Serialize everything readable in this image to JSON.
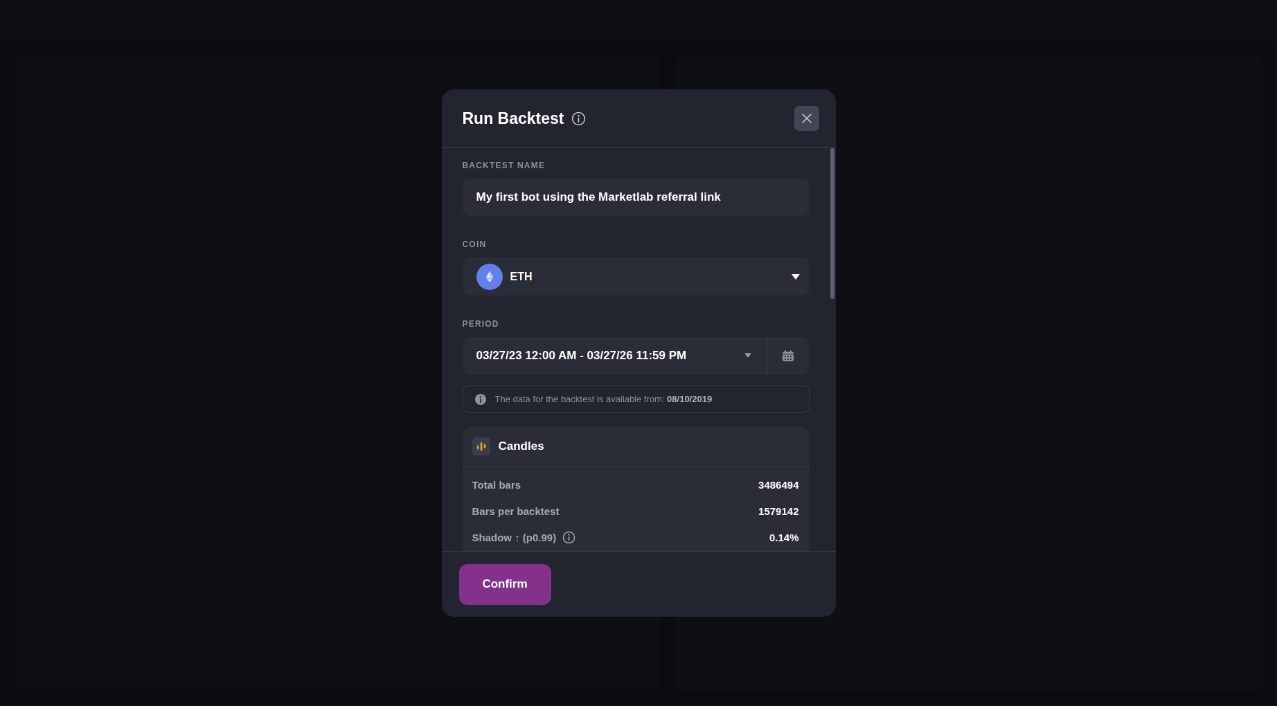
{
  "dialog": {
    "title": "Run Backtest",
    "fields": [
      {
        "kind": "text",
        "label": "BACKTEST NAME",
        "value": "My first bot using the Marketlab referral link"
      },
      {
        "kind": "coin",
        "label": "COIN",
        "value": "ETH"
      },
      {
        "kind": "daterange",
        "label": "PERIOD",
        "value": "03/27/23 12:00 AM - 03/27/26 11:59 PM"
      }
    ],
    "notice": "The data for the backtest is available from: **08/10/2019**",
    "stats": {
      "title": "Candles",
      "rows": [
        {
          "label": "Total bars",
          "value": "3486494",
          "info": false
        },
        {
          "label": "Bars per backtest",
          "value": "1579142",
          "info": false
        },
        {
          "label": "Shadow ↑ (p0.99)",
          "value": "0.14%",
          "info": true
        }
      ]
    },
    "confirm": "Confirm"
  }
}
